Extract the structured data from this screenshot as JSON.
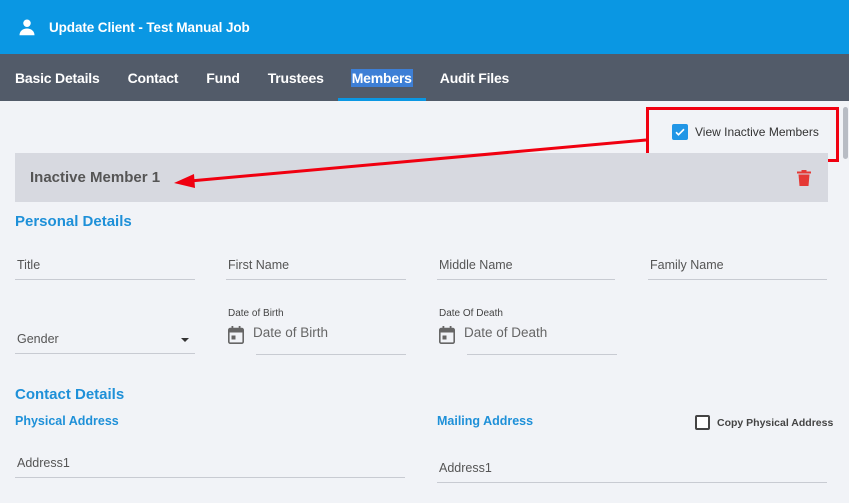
{
  "header": {
    "title": "Update Client - Test Manual Job",
    "icon": "user-icon"
  },
  "tabs": [
    {
      "label": "Basic Details",
      "active": false
    },
    {
      "label": "Contact",
      "active": false
    },
    {
      "label": "Fund",
      "active": false
    },
    {
      "label": "Trustees",
      "active": false
    },
    {
      "label": "Members",
      "active": true
    },
    {
      "label": "Audit Files",
      "active": false
    }
  ],
  "view_inactive": {
    "label": "View Inactive Members",
    "checked": true
  },
  "member": {
    "title": "Inactive Member 1",
    "delete_icon": "trash-icon"
  },
  "personal": {
    "title": "Personal Details",
    "title_field": "Title",
    "first_name": "First Name",
    "middle_name": "Middle Name",
    "family_name": "Family Name",
    "gender": "Gender",
    "dob_label": "Date of Birth",
    "dob_placeholder": "Date of Birth",
    "dod_label": "Date Of Death",
    "dod_placeholder": "Date of Death"
  },
  "contact": {
    "title": "Contact Details",
    "physical_title": "Physical Address",
    "mailing_title": "Mailing Address",
    "copy_label": "Copy Physical Address",
    "copy_checked": false,
    "physical_address1": "Address1",
    "mailing_address1": "Address1"
  },
  "colors": {
    "header_bg": "#0a97e3",
    "tabbar_bg": "#525b69",
    "accent": "#1e90d8",
    "annotation_red": "#f00010",
    "trash_red": "#e53935"
  }
}
